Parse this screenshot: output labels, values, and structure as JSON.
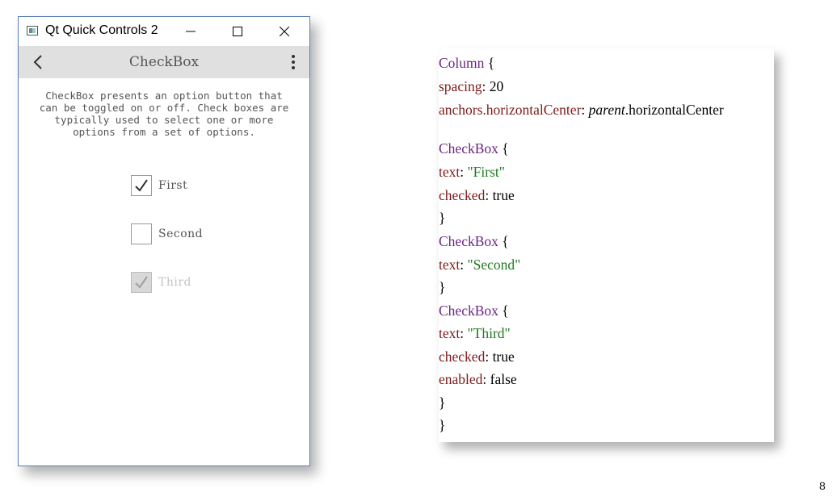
{
  "window": {
    "title": "Qt Quick Controls 2",
    "toolbar_title": "CheckBox",
    "description": "CheckBox presents an option button that\ncan be toggled on or off. Check boxes are\ntypically used to select one or more\noptions from a set of options.",
    "checkboxes": [
      {
        "label": "First",
        "checked": true,
        "enabled": true
      },
      {
        "label": "Second",
        "checked": false,
        "enabled": true
      },
      {
        "label": "Third",
        "checked": true,
        "enabled": false
      }
    ]
  },
  "code": {
    "column_kw": "Column",
    "brace_open": " {",
    "brace_close": "}",
    "spacing_prop": "spacing",
    "spacing_val": ": 20",
    "anchors_prop": "anchors.horizontalCenter",
    "anchors_sep": ": ",
    "anchors_parent": "parent",
    "anchors_rest": ".horizontalCenter",
    "checkbox_kw": "CheckBox",
    "text_prop": "text",
    "colon": ": ",
    "checked_prop": "checked",
    "checked_val": ": true",
    "enabled_prop": "enabled",
    "enabled_val": ": false",
    "str_first": "\"First\"",
    "str_second": "\"Second\"",
    "str_third": "\"Third\""
  },
  "page_number": "8",
  "colors": {
    "keyword": "#6a2580",
    "property": "#7a1b1b",
    "string": "#1f7a1f",
    "toolbar": "#e0e0e0"
  }
}
